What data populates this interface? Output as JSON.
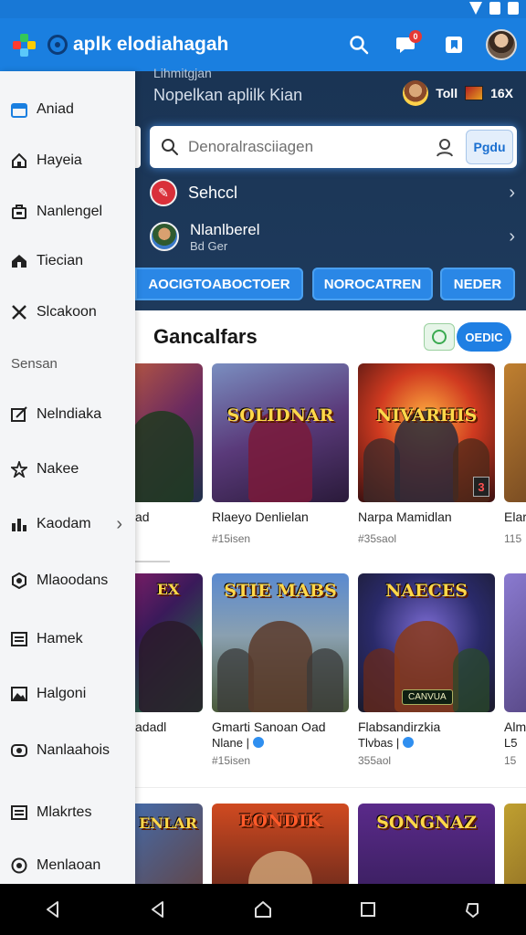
{
  "app_bar": {
    "title": "aplk elodiahagah",
    "notification_count": "0"
  },
  "header": {
    "crumb": "Lihmitgjan",
    "subtitle": "Nopelkan aplilk Kian",
    "stat_1": "Toll",
    "stat_2": "16X"
  },
  "search": {
    "placeholder": "Denoralrasciiagen",
    "button_label": "Pgdu"
  },
  "panel_rows": {
    "row1_label": "Sehccl",
    "row2_label": "Nlanlberel",
    "row2_sub": "Bd Ger"
  },
  "tabs": [
    "AOCIGTOABOCTOER",
    "NOROCATREN",
    "NEDER"
  ],
  "section": {
    "title": "Gancalfars",
    "chip_label": "OEDIC"
  },
  "cards_row1": [
    {
      "thumb_text": "",
      "title": "ad",
      "meta": ""
    },
    {
      "thumb_text": "SOLIDNAR",
      "title": "Rlaeyo Denlielan",
      "meta": "#15isen"
    },
    {
      "thumb_text": "NIVARHIS",
      "title": "Narpa Mamidlan",
      "meta": "#35saol",
      "corner": "3"
    },
    {
      "thumb_text": "",
      "title": "Elar",
      "meta": "115"
    }
  ],
  "cards_row2": [
    {
      "thumb_text": "EX",
      "title": "adadl",
      "title2": "",
      "meta": ""
    },
    {
      "thumb_text": "STIE MABS",
      "title": "Gmarti Sanoan Oad",
      "title2": "Nlane |",
      "meta": "#15isen"
    },
    {
      "thumb_text": "NAECES",
      "title": "Flabsandirzkia",
      "title2": "Tlvbas |",
      "meta": "355aol",
      "badge": "CANVUA"
    },
    {
      "thumb_text": "",
      "title": "Alm",
      "title2": "L5",
      "meta": "15"
    }
  ],
  "cards_row3": [
    {
      "thumb_text": "ENLAR"
    },
    {
      "thumb_text": "EONDIK"
    },
    {
      "thumb_text": "SONGNAZ"
    }
  ],
  "drawer": {
    "items": [
      {
        "label": "Aniad",
        "icon": "calendar-icon"
      },
      {
        "label": "Hayeia",
        "icon": "home-icon"
      },
      {
        "label": "Nanlengel",
        "icon": "briefcase-icon"
      },
      {
        "label": "Tiecian",
        "icon": "house-icon"
      },
      {
        "label": "Slcakoon",
        "icon": "tools-icon"
      }
    ],
    "section_label": "Sensan",
    "items2": [
      {
        "label": "Nelndiaka",
        "icon": "edit-icon"
      },
      {
        "label": "Nakee",
        "icon": "star-icon"
      },
      {
        "label": "Kaodam",
        "icon": "bar-chart-icon"
      },
      {
        "label": "Mlaoodans",
        "icon": "hexagon-icon"
      },
      {
        "label": "Hamek",
        "icon": "list-icon"
      },
      {
        "label": "Halgoni",
        "icon": "image-icon"
      },
      {
        "label": "Nanlaahois",
        "icon": "eye-icon"
      },
      {
        "label": "Mlakrtes",
        "icon": "list-icon"
      },
      {
        "label": "Menlaoan",
        "icon": "help-icon"
      }
    ]
  },
  "colors": {
    "primary": "#1a7fe0",
    "dark_panel": "#1e3a5c",
    "drawer_bg": "#f4f5f7"
  }
}
